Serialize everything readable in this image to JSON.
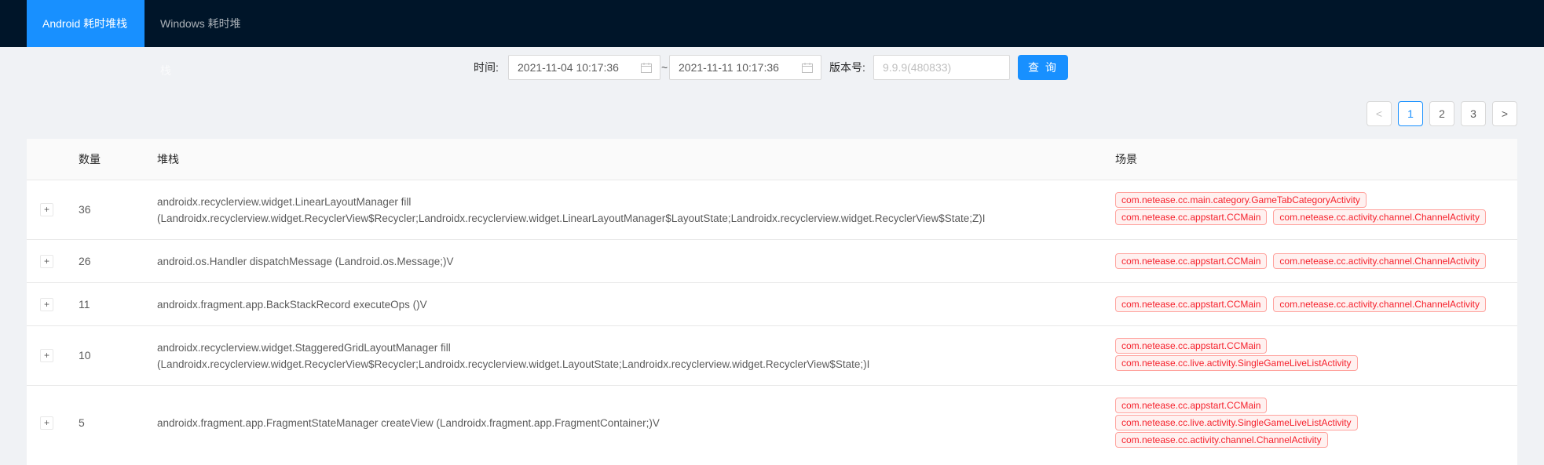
{
  "tabs": [
    {
      "label": "Android 耗时堆栈",
      "active": true
    },
    {
      "label": "Windows 耗时堆栈",
      "active": false
    }
  ],
  "filter": {
    "time_label": "时间:",
    "start_date": "2021-11-04 10:17:36",
    "separator": "~",
    "end_date": "2021-11-11 10:17:36",
    "version_label": "版本号:",
    "version_placeholder": "9.9.9(480833)",
    "query_label": "查 询"
  },
  "pagination": {
    "prev": "<",
    "pages": [
      "1",
      "2",
      "3"
    ],
    "current": "1",
    "next": ">"
  },
  "table": {
    "columns": {
      "count": "数量",
      "stack": "堆栈",
      "scene": "场景"
    },
    "rows": [
      {
        "count": "36",
        "stack_line1": "androidx.recyclerview.widget.LinearLayoutManager fill",
        "stack_line2": "(Landroidx.recyclerview.widget.RecyclerView$Recycler;Landroidx.recyclerview.widget.LinearLayoutManager$LayoutState;Landroidx.recyclerview.widget.RecyclerView$State;Z)I",
        "scenes": [
          "com.netease.cc.main.category.GameTabCategoryActivity",
          "com.netease.cc.appstart.CCMain",
          "com.netease.cc.activity.channel.ChannelActivity"
        ]
      },
      {
        "count": "26",
        "stack_line1": "android.os.Handler dispatchMessage (Landroid.os.Message;)V",
        "stack_line2": "",
        "scenes": [
          "com.netease.cc.appstart.CCMain",
          "com.netease.cc.activity.channel.ChannelActivity"
        ]
      },
      {
        "count": "11",
        "stack_line1": "androidx.fragment.app.BackStackRecord executeOps ()V",
        "stack_line2": "",
        "scenes": [
          "com.netease.cc.appstart.CCMain",
          "com.netease.cc.activity.channel.ChannelActivity"
        ]
      },
      {
        "count": "10",
        "stack_line1": "androidx.recyclerview.widget.StaggeredGridLayoutManager fill",
        "stack_line2": "(Landroidx.recyclerview.widget.RecyclerView$Recycler;Landroidx.recyclerview.widget.LayoutState;Landroidx.recyclerview.widget.RecyclerView$State;)I",
        "scenes": [
          "com.netease.cc.appstart.CCMain",
          "com.netease.cc.live.activity.SingleGameLiveListActivity"
        ]
      },
      {
        "count": "5",
        "stack_line1": "androidx.fragment.app.FragmentStateManager createView (Landroidx.fragment.app.FragmentContainer;)V",
        "stack_line2": "",
        "scenes": [
          "com.netease.cc.appstart.CCMain",
          "com.netease.cc.live.activity.SingleGameLiveListActivity",
          "com.netease.cc.activity.channel.ChannelActivity"
        ]
      }
    ]
  },
  "colors": {
    "header_bg": "#001529",
    "accent": "#1890ff",
    "tag_red": "#f5222d"
  }
}
